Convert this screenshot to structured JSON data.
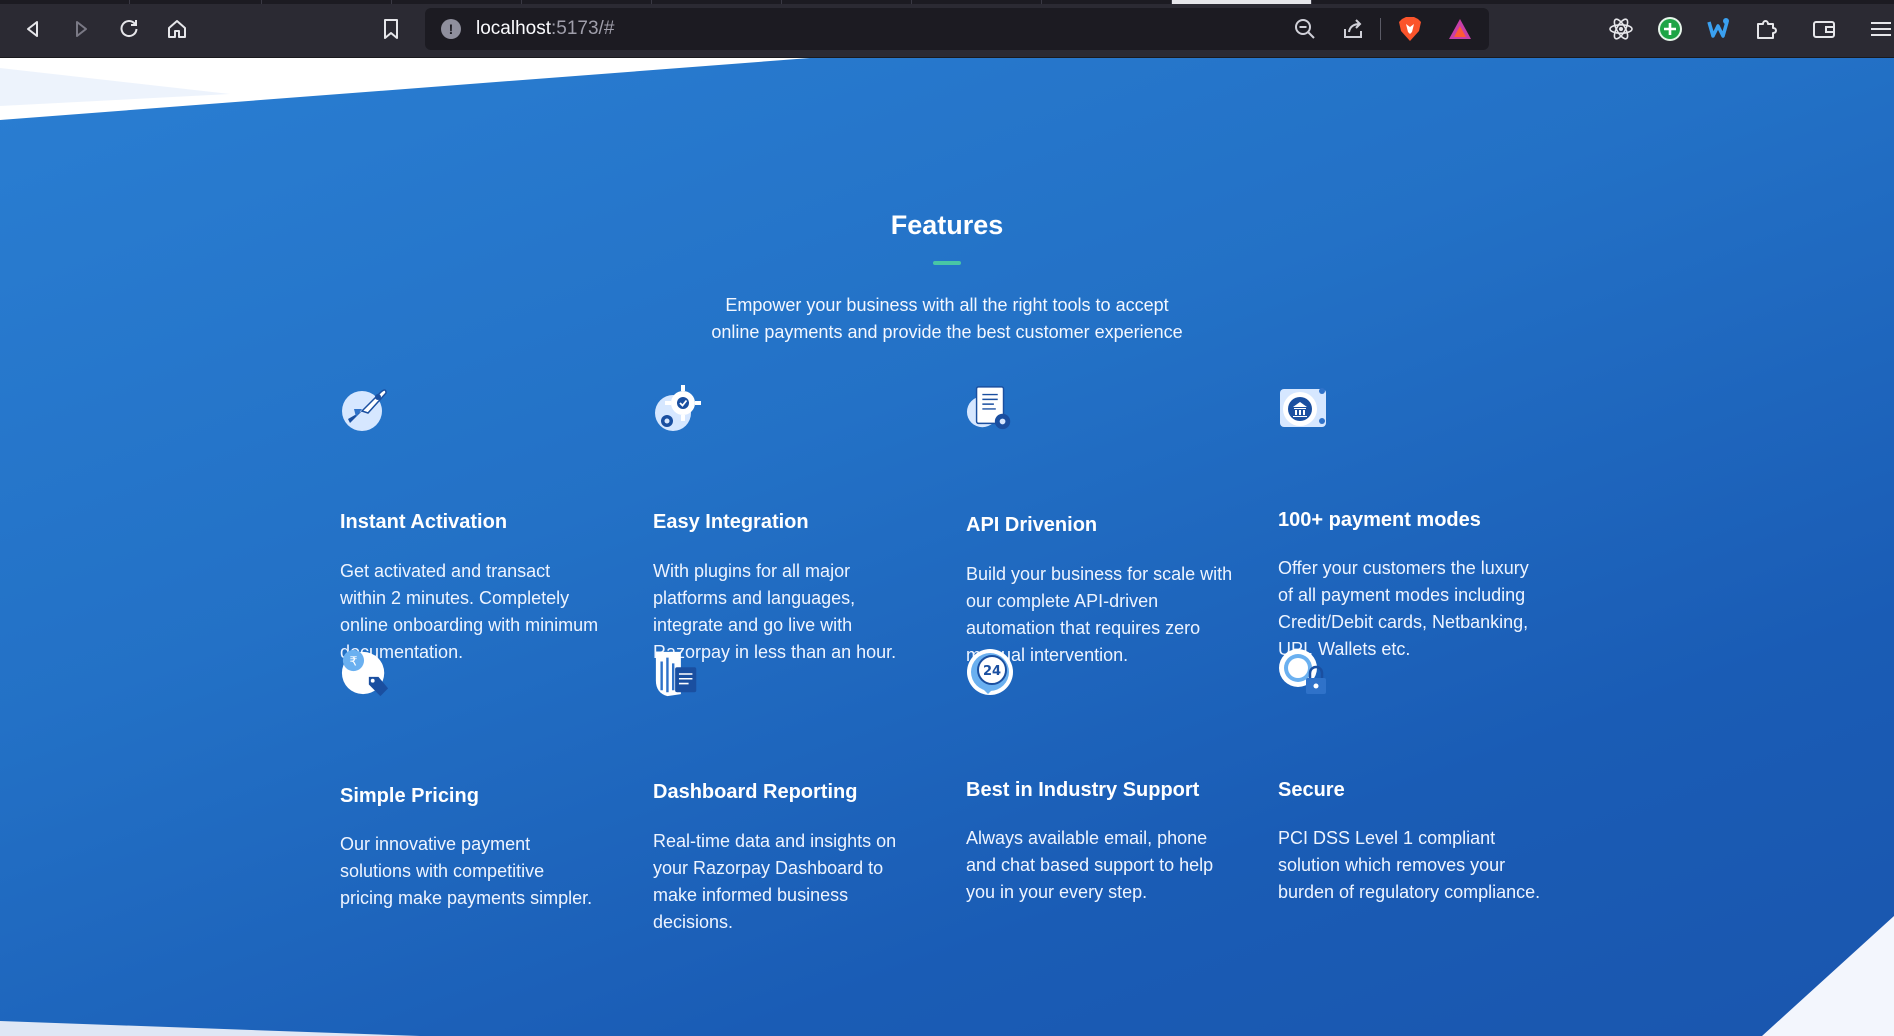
{
  "browser": {
    "address": {
      "host": "localhost",
      "rest": ":5173/#"
    },
    "icons": {
      "back": "back-arrow-icon",
      "forward": "forward-arrow-icon",
      "reload": "reload-icon",
      "home": "home-icon",
      "bookmark": "bookmark-icon",
      "site_info": "info-icon",
      "zoom": "zoom-out-icon",
      "share": "share-icon",
      "brave": "brave-shields-icon",
      "rewards": "brave-rewards-icon",
      "react_devtools": "react-icon",
      "add_extension": "plus-circle-icon",
      "extension_w": "w-extension-icon",
      "extensions": "puzzle-icon",
      "wallet": "wallet-icon",
      "menu": "hamburger-menu-icon"
    }
  },
  "features": {
    "title": "Features",
    "subtitle_line1": "Empower your business with all the right tools to accept",
    "subtitle_line2": "online payments and provide the best customer experience",
    "colors": {
      "accent_bar": "#48c6a5",
      "bg_top": "#2a7ed2",
      "bg_bottom": "#1a56ae"
    },
    "cards": [
      {
        "icon": "rocket-icon",
        "title": "Instant Activation",
        "desc": [
          "Get activated and transact",
          "within 2 minutes. Completely",
          "online onboarding with minimum",
          "documentation."
        ]
      },
      {
        "icon": "gear-check-icon",
        "title": "Easy Integration",
        "desc": [
          "With plugins for all major",
          "platforms and languages,",
          "integrate and go live with",
          "Razorpay in less than an hour."
        ]
      },
      {
        "icon": "document-gear-icon",
        "title": "API Drivenion",
        "desc": [
          "Build your business for scale with",
          "our complete API-driven",
          "automation that requires zero",
          "manual intervention."
        ]
      },
      {
        "icon": "bank-card-icon",
        "title": "100+ payment modes",
        "desc": [
          "Offer your customers the luxury",
          "of all payment modes including",
          "Credit/Debit cards, Netbanking,",
          "UPI, Wallets etc."
        ]
      },
      {
        "icon": "rupee-tag-icon",
        "title": "Simple Pricing",
        "desc": [
          "Our innovative payment",
          "solutions with competitive",
          "pricing make payments simpler."
        ]
      },
      {
        "icon": "dashboard-report-icon",
        "title": "Dashboard Reporting",
        "desc": [
          "Real-time data and insights on",
          "your Razorpay Dashboard to",
          "make informed business",
          "decisions."
        ]
      },
      {
        "icon": "support-24-icon",
        "title": "Best in Industry Support",
        "desc": [
          "Always available email, phone",
          "and chat based support to help",
          "you in your every step."
        ]
      },
      {
        "icon": "secure-lock-icon",
        "title": "Secure",
        "desc": [
          "PCI DSS Level 1 compliant",
          "solution which removes your",
          "burden of regulatory compliance."
        ]
      }
    ]
  }
}
